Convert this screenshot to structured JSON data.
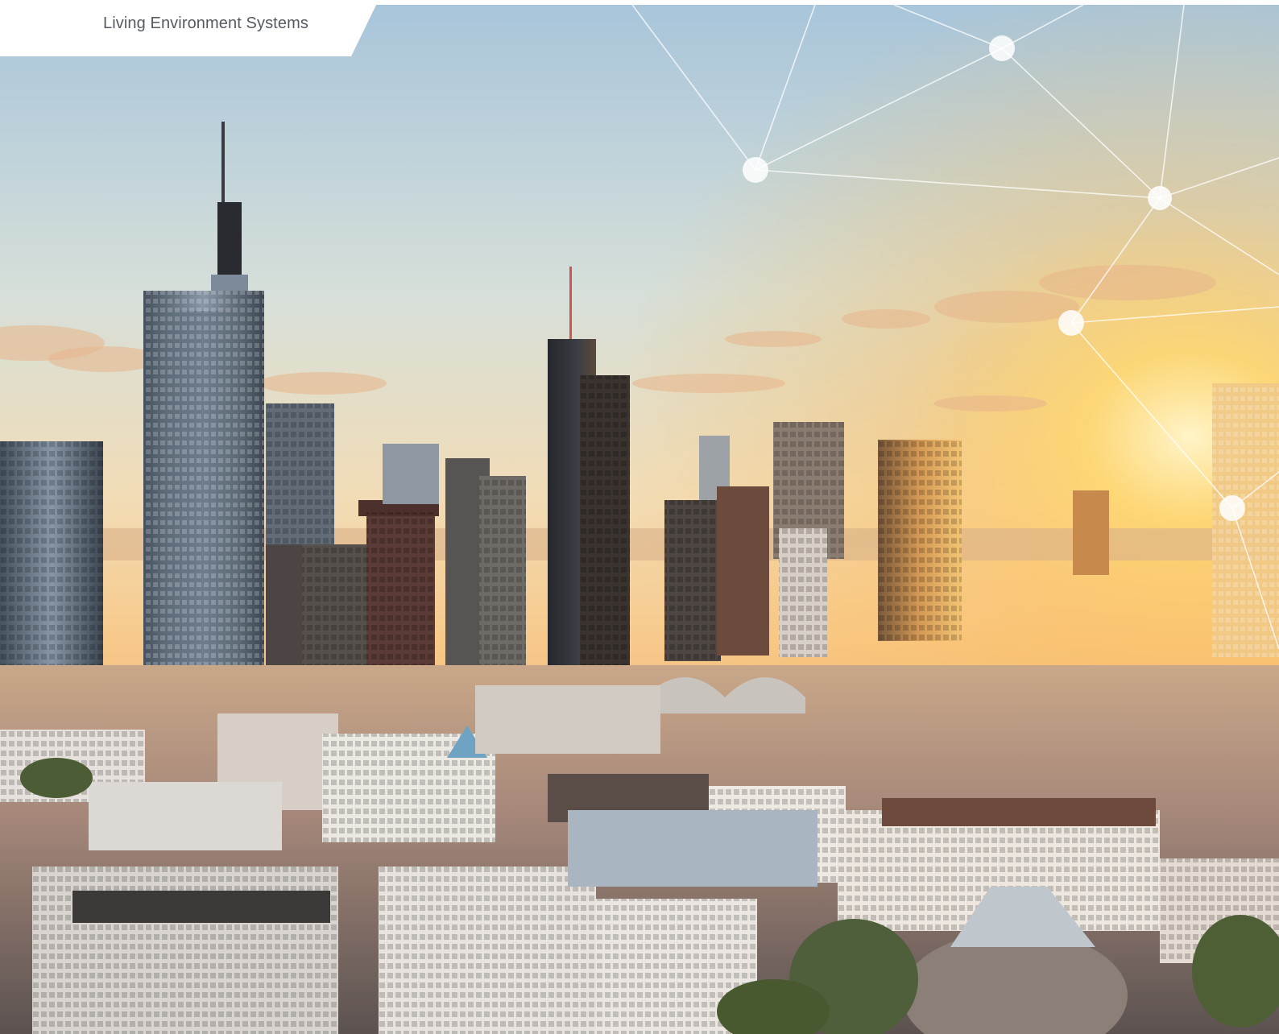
{
  "header": {
    "brand_label": "Living Environment Systems"
  },
  "hero": {
    "image_subject": "city-skyline-photo",
    "network_overlay_icon": "network-nodes-icon"
  },
  "colors": {
    "sky_top": "#a9c6db",
    "sky_mid": "#f2d9b0",
    "sun_glow": "#ffd36a",
    "building_dark": "#2d2f35",
    "building_glass": "#5d6b7c",
    "city_warm": "#b88a68",
    "overlay_line": "#ffffff",
    "brand_text": "#555b62"
  }
}
